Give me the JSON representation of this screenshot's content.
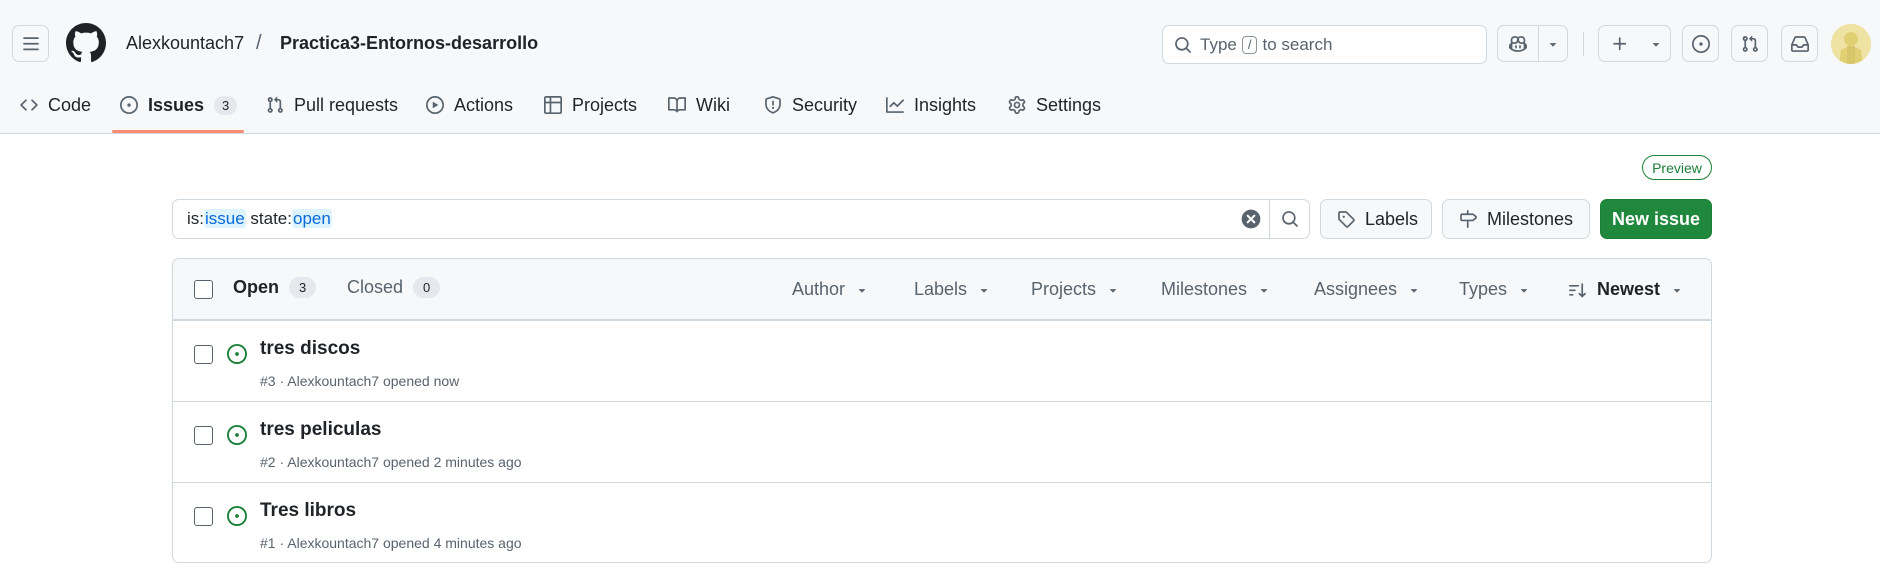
{
  "header": {
    "owner": "Alexkountach7",
    "separator": "/",
    "repo": "Practica3-Entornos-desarrollo",
    "search": {
      "prefix": "Type",
      "key": "/",
      "suffix": "to search"
    }
  },
  "tabs": [
    {
      "label": "Code",
      "icon": "code-icon"
    },
    {
      "label": "Issues",
      "icon": "issue-opened-icon",
      "count": "3",
      "selected": true
    },
    {
      "label": "Pull requests",
      "icon": "git-pull-request-icon"
    },
    {
      "label": "Actions",
      "icon": "play-icon"
    },
    {
      "label": "Projects",
      "icon": "table-icon"
    },
    {
      "label": "Wiki",
      "icon": "book-icon"
    },
    {
      "label": "Security",
      "icon": "shield-icon"
    },
    {
      "label": "Insights",
      "icon": "graph-icon"
    },
    {
      "label": "Settings",
      "icon": "gear-icon"
    }
  ],
  "preview_label": "Preview",
  "filter": {
    "p1": "is:",
    "v1": "issue",
    "p2": " state:",
    "v2": "open"
  },
  "buttons": {
    "labels": "Labels",
    "milestones": "Milestones",
    "new_issue": "New issue"
  },
  "list": {
    "open_label": "Open",
    "open_count": "3",
    "closed_label": "Closed",
    "closed_count": "0",
    "filters": [
      "Author",
      "Labels",
      "Projects",
      "Milestones",
      "Assignees",
      "Types"
    ],
    "sort_label": "Newest"
  },
  "issues": [
    {
      "title": "tres discos",
      "meta": "#3 · Alexkountach7 opened now"
    },
    {
      "title": "tres peliculas",
      "meta": "#2 · Alexkountach7 opened 2 minutes ago"
    },
    {
      "title": "Tres libros",
      "meta": "#1 · Alexkountach7 opened 4 minutes ago"
    }
  ],
  "colors": {
    "accent_green": "#1f883d",
    "open_icon": "#1a7f37",
    "tab_underline": "#fd8c73",
    "link_blue": "#0969da"
  }
}
